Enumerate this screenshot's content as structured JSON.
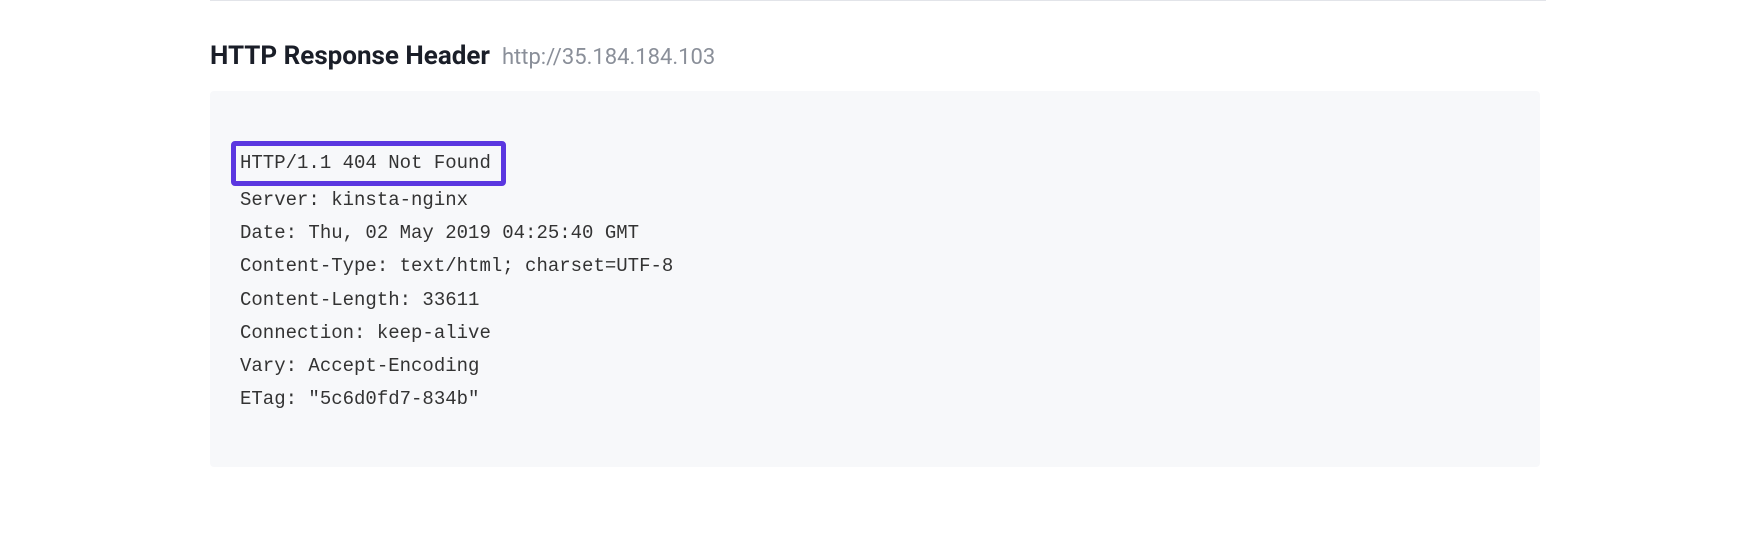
{
  "section": {
    "title": "HTTP Response Header",
    "url": "http://35.184.184.103"
  },
  "response": {
    "status_line": "HTTP/1.1 404 Not Found",
    "headers": [
      "Server: kinsta-nginx",
      "Date: Thu, 02 May 2019 04:25:40 GMT",
      "Content-Type: text/html; charset=UTF-8",
      "Content-Length: 33611",
      "Connection: keep-alive",
      "Vary: Accept-Encoding",
      "ETag: \"5c6d0fd7-834b\""
    ]
  }
}
